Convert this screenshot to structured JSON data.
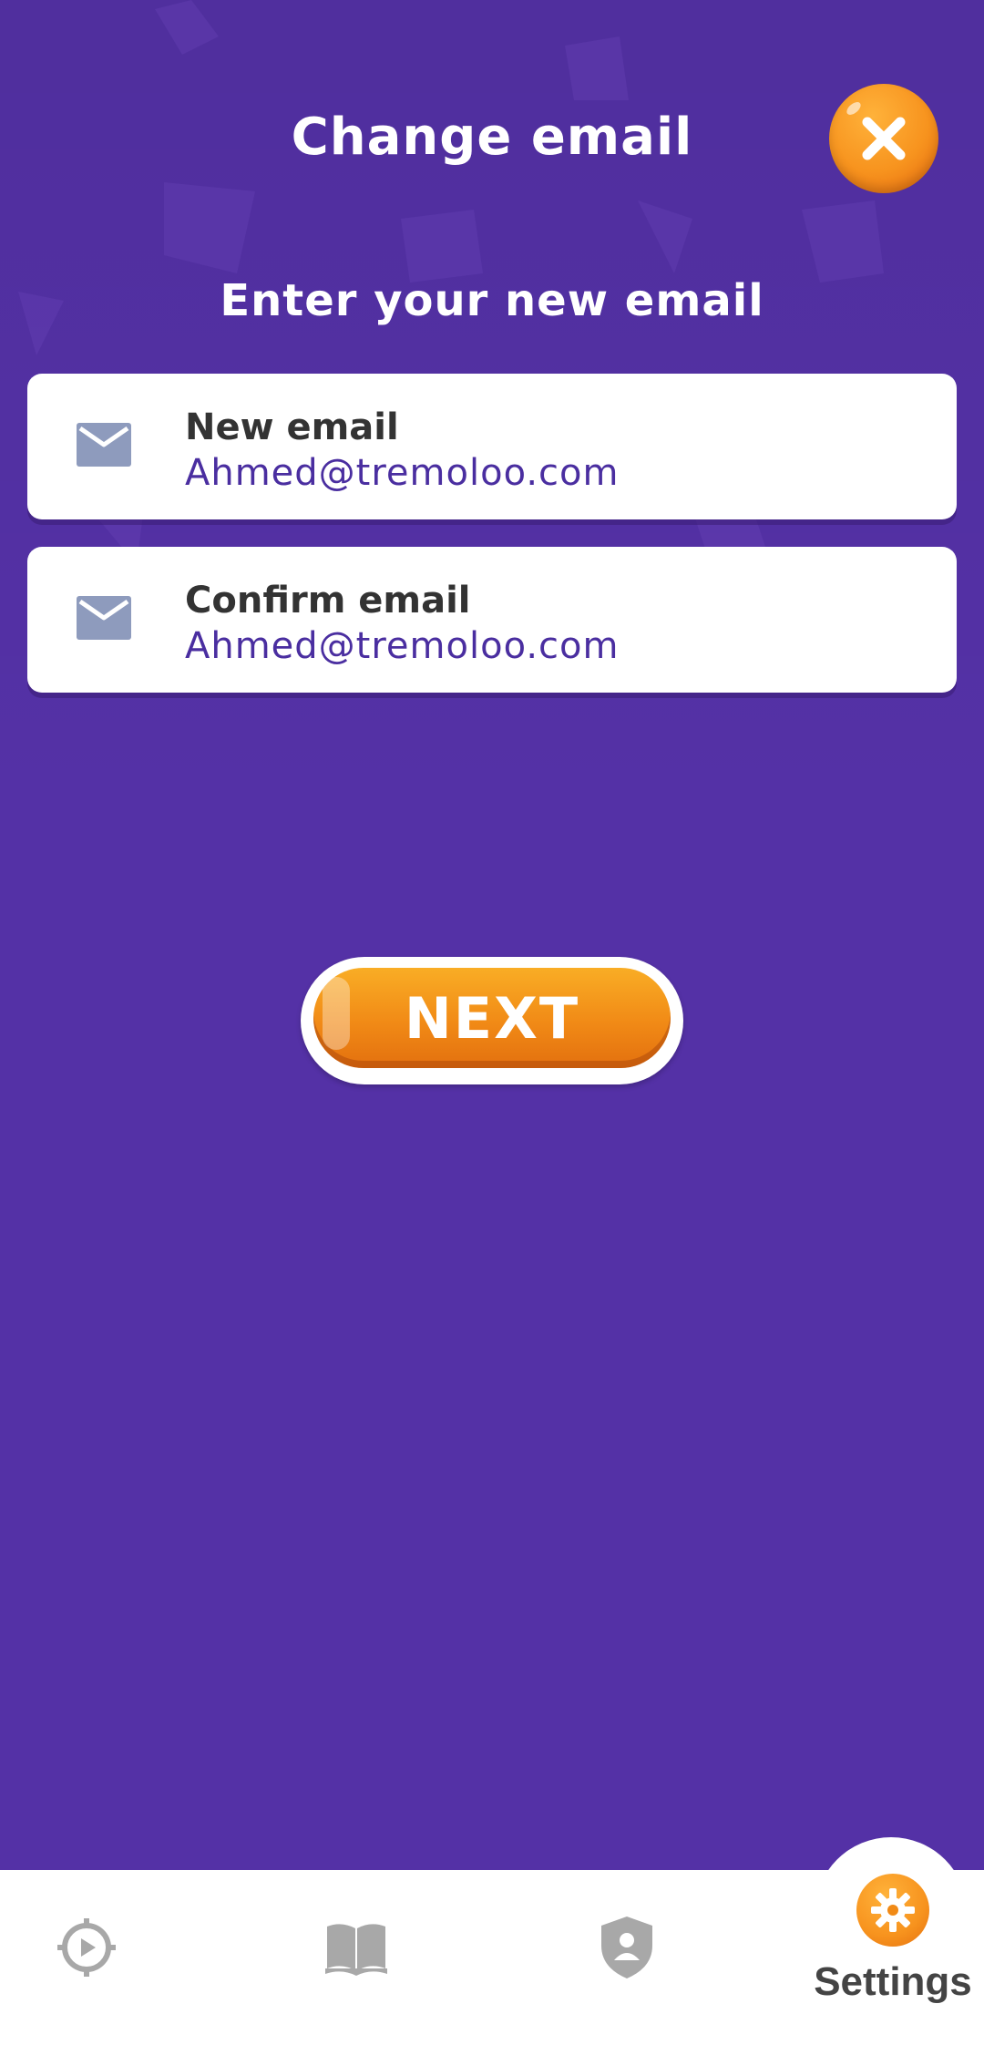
{
  "header": {
    "title": "Change email"
  },
  "form": {
    "subtitle": "Enter your new email",
    "new_email": {
      "label": "New email",
      "value": "Ahmed@tremoloo.com"
    },
    "confirm_email": {
      "label": "Confirm email",
      "value": "Ahmed@tremoloo.com"
    },
    "next_label": "NEXT"
  },
  "bottom_nav": {
    "items": [
      {
        "icon": "play-compass-icon"
      },
      {
        "icon": "book-icon"
      },
      {
        "icon": "profile-shield-icon"
      },
      {
        "icon": "gear-icon",
        "label": "Settings",
        "active": true
      }
    ]
  },
  "colors": {
    "background": "#5431a6",
    "accent": "#f7931e",
    "value_text": "#4a2ea0",
    "envelope": "#8e9bbd"
  }
}
